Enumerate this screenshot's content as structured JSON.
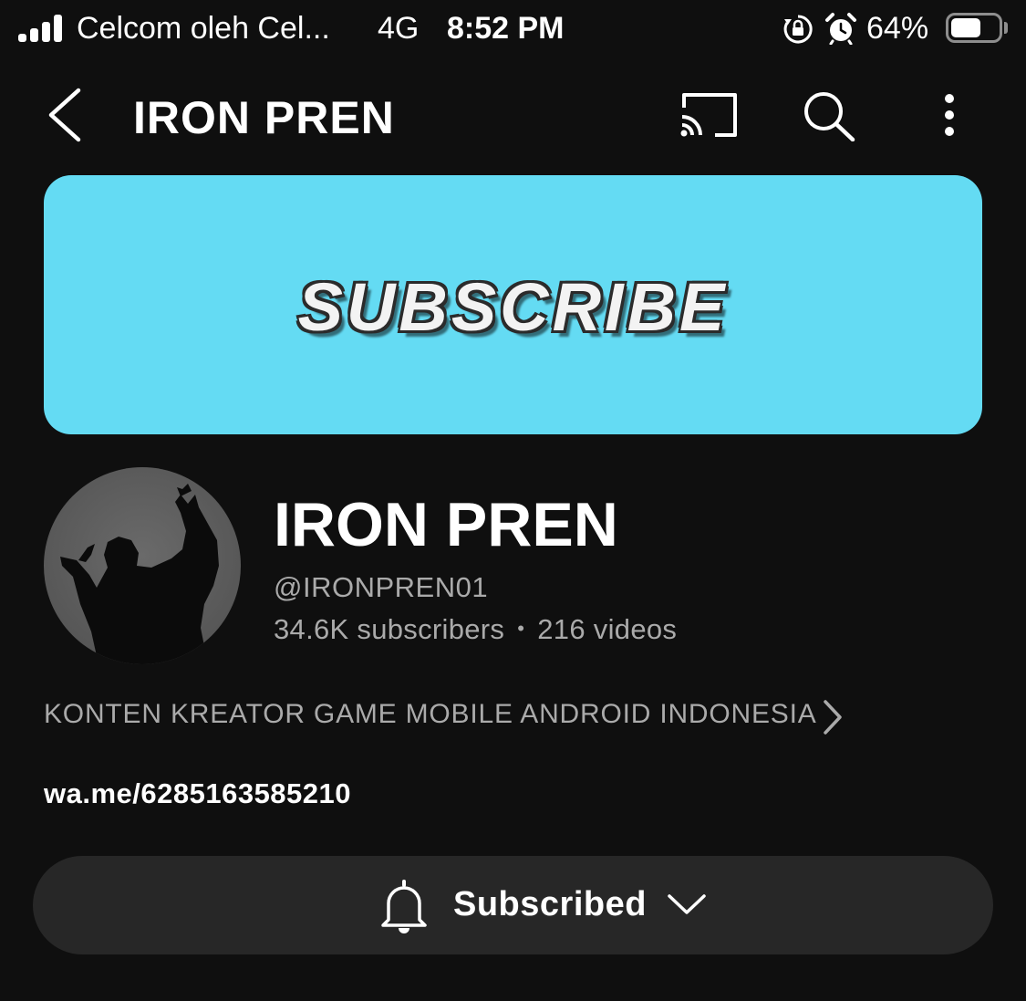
{
  "status_bar": {
    "carrier": "Celcom oleh Cel...",
    "network": "4G",
    "time": "8:52 PM",
    "battery_percent": "64%",
    "battery_level": 0.64,
    "icons": [
      "signal-icon",
      "rotation-lock-icon",
      "alarm-icon",
      "battery-icon"
    ]
  },
  "header": {
    "title": "IRON PREN",
    "icons": [
      "back-icon",
      "cast-icon",
      "search-icon",
      "more-icon"
    ]
  },
  "banner": {
    "text": "SUBSCRIBE",
    "background_color": "#64dbf3"
  },
  "channel": {
    "name": "IRON PREN",
    "handle": "@IRONPREN01",
    "subscribers": "34.6K subscribers",
    "separator": "•",
    "videos": "216 videos",
    "description": "KONTEN KREATOR GAME MOBILE ANDROID INDONESIA",
    "link": "wa.me/6285163585210"
  },
  "subscribe_button": {
    "label": "Subscribed",
    "icons": [
      "bell-icon",
      "chevron-down-icon"
    ]
  },
  "colors": {
    "background": "#0f0f0f",
    "secondary_text": "#aaaaaa",
    "button_background": "#272727"
  }
}
